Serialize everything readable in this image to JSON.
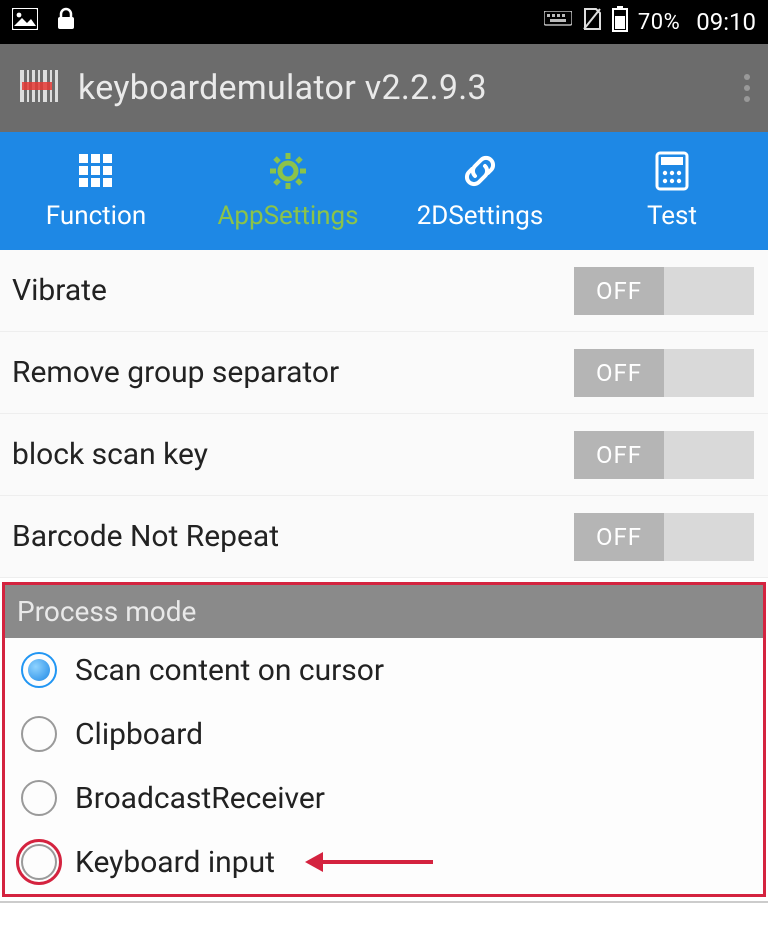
{
  "status_bar": {
    "battery_percent": "70%",
    "time": "09:10"
  },
  "app_bar": {
    "title": "keyboardemulator v2.2.9.3"
  },
  "tabs": [
    {
      "label": "Function"
    },
    {
      "label": "AppSettings"
    },
    {
      "label": "2DSettings"
    },
    {
      "label": "Test"
    }
  ],
  "settings": [
    {
      "label": "Vibrate",
      "toggle": "OFF"
    },
    {
      "label": "Remove group separator",
      "toggle": "OFF"
    },
    {
      "label": "block scan key",
      "toggle": "OFF"
    },
    {
      "label": "Barcode Not Repeat",
      "toggle": "OFF"
    }
  ],
  "process_mode": {
    "header": "Process mode",
    "options": [
      {
        "label": "Scan content on cursor",
        "selected": true
      },
      {
        "label": "Clipboard",
        "selected": false
      },
      {
        "label": "BroadcastReceiver",
        "selected": false
      },
      {
        "label": "Keyboard input",
        "selected": false
      }
    ]
  }
}
